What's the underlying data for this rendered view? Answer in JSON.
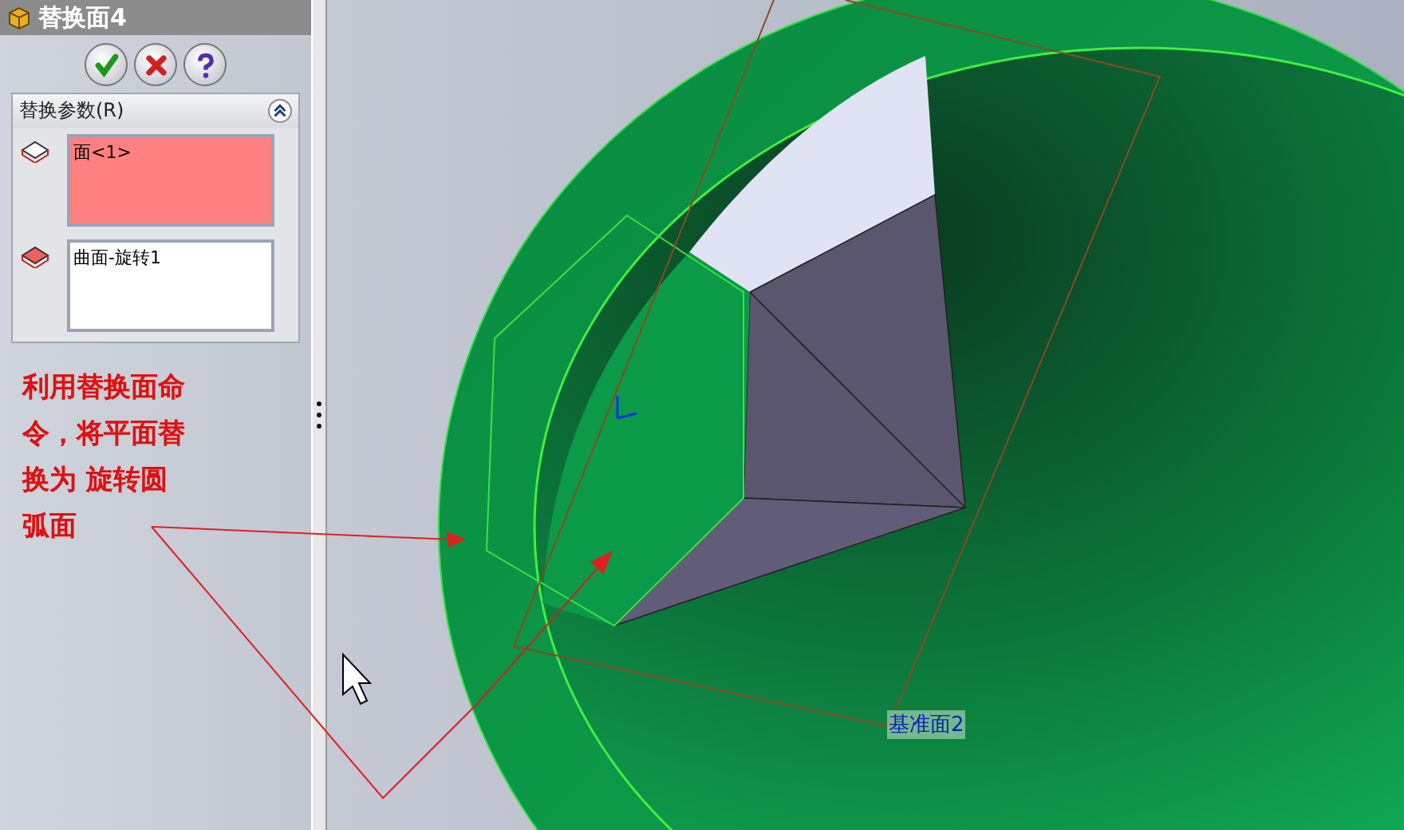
{
  "property_manager": {
    "title": "替换面4",
    "buttons": [
      {
        "kind": "ok"
      },
      {
        "kind": "cancel"
      },
      {
        "kind": "help"
      }
    ],
    "section": {
      "title": "替换参数(R)",
      "expanded": true,
      "selections": [
        {
          "kind": "target",
          "text": "面<1>",
          "selected": true
        },
        {
          "kind": "replacement",
          "text": "曲面-旋转1",
          "selected": false
        }
      ]
    }
  },
  "annotation": {
    "text": "利用替换面命令，将平面替换为 旋转圆弧面"
  },
  "viewport": {
    "plane_label": "基准面2"
  }
}
